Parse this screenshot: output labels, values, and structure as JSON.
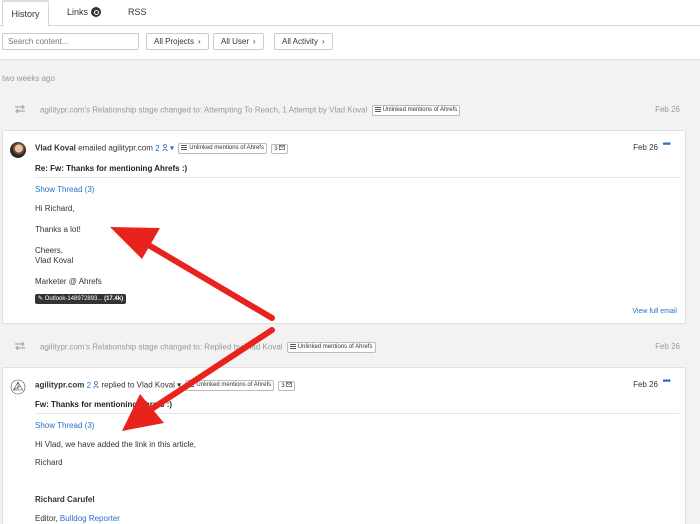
{
  "tabs": [
    {
      "label": "History",
      "active": true
    },
    {
      "label": "Links",
      "active": false
    },
    {
      "label": "RSS",
      "active": false
    }
  ],
  "filters": {
    "search_placeholder": "Search content...",
    "projects": "All Projects",
    "user": "All User",
    "activity": "All Activity"
  },
  "period_label": "two weeks ago",
  "activities": [
    {
      "text": "agilitypr.com's Relationship stage changed to: Attempting To Reach, 1 Attempt by Vlad Koval",
      "tag": "Unlinked mentions of Ahrefs",
      "date": "Feb 26"
    },
    {
      "text": "agilitypr.com's Relationship stage changed to: Replied by Vlad Koval",
      "tag": "Unlinked mentions of Ahrefs",
      "date": "Feb 26"
    }
  ],
  "emails": [
    {
      "sender": "Vlad Koval",
      "verb": "emailed",
      "recipient": "agilitypr.com",
      "people_count": "2",
      "tag": "Unlinked mentions of Ahrefs",
      "msg_count": "3",
      "date": "Feb 26",
      "subject": "Re: Fw: Thanks for mentioning Ahrefs :)",
      "thread_label": "Show Thread (3)",
      "body": [
        "Hi Richard,",
        "Thanks a lot!",
        "Cheers,",
        "Vlad Koval",
        "Marketer @ Ahrefs"
      ],
      "attachment_name": "Outlook-148972893...",
      "attachment_size": "(17.4k)",
      "view_full": "View full email"
    },
    {
      "sender": "agilitypr.com",
      "people_count": "2",
      "verb": "replied to",
      "recipient": "Vlad Koval",
      "tag": "Unlinked mentions of Ahrefs",
      "msg_count": "3",
      "date": "Feb 26",
      "subject": "Fw: Thanks for mentioning Ahrefs :)",
      "thread_label": "Show Thread (3)",
      "body": [
        "Hi Vlad, we have added the link in this article,",
        "Richard"
      ],
      "signature_name": "Richard Carufel",
      "signature_role": "Editor,",
      "signature_company": "Bulldog Reporter"
    }
  ],
  "colors": {
    "link": "#2a6fcb",
    "annotation_arrow": "#e8231d"
  },
  "icons": {
    "swap": "swap-arrows-icon",
    "more": "more-dots-icon",
    "person": "person-icon",
    "envelope": "envelope-icon",
    "caret": "caret-down-icon",
    "paperclip": "paperclip-icon"
  }
}
